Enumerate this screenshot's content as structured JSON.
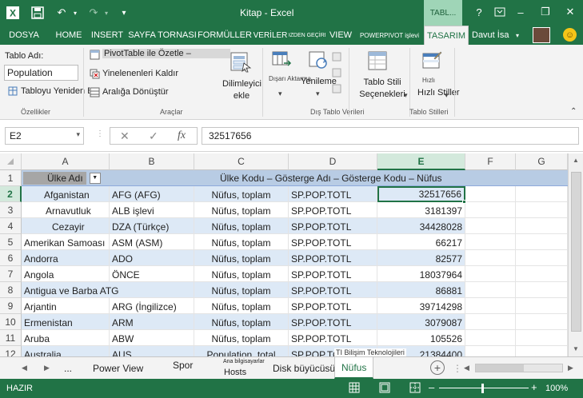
{
  "titlebar": {
    "title": "Kitap - Excel",
    "context_tab": "TABL...",
    "help": "?",
    "min": "–",
    "restore": "❐",
    "close": "✕"
  },
  "tabs": [
    {
      "label": "DOSYA"
    },
    {
      "label": "HOME"
    },
    {
      "label": "INSERT"
    },
    {
      "label": "SAYFA TORNASI"
    },
    {
      "label": "FORMÜLLER"
    },
    {
      "label": "VERİLER"
    },
    {
      "label": "GÖZDEN GEÇİRME"
    },
    {
      "label": "VIEW"
    },
    {
      "label": "POWERPIVOT işlevi"
    },
    {
      "label": "TASARIM"
    }
  ],
  "user": {
    "name": "Davut İsa"
  },
  "ribbon": {
    "table_name_label": "Tablo Adı:",
    "table_name_value": "Population",
    "resize_table": "Tabloyu Yeniden Bo...",
    "group_properties": "Özellikler",
    "pivot_summarize": "PivotTable ile Özetle –",
    "remove_duplicates": "Yinelenenleri Kaldır",
    "convert_to_range": "Aralığa Dönüştür",
    "slicer": "Dilimleyici ekle",
    "group_tools": "Araçlar",
    "export": "Dışarı Aktarma",
    "refresh": "Yenileme",
    "group_external": "Dış Tablo Verileri",
    "style_options": "Tablo Stili Seçenekleri",
    "quick_styles": "Hızlı Stiller",
    "quick_styles_small": "Hızlı",
    "group_styles": "Tablo Stilleri"
  },
  "formula_bar": {
    "name_box": "E2",
    "cancel": "✕",
    "enter": "✓",
    "fx": "fx",
    "value": "32517656"
  },
  "grid": {
    "columns": [
      "A",
      "B",
      "C",
      "D",
      "E",
      "F",
      "G"
    ],
    "header_row": {
      "col_a": "Ülke Adı",
      "merged": "Ülke Kodu – Gösterge Adı – Gösterge Kodu – Nüfus"
    },
    "rows": [
      {
        "n": "1"
      },
      {
        "n": "2",
        "a": "Afganistan",
        "b": "AFG (AFG)",
        "c": "Nüfus, toplam",
        "d": "SP.POP.TOTL",
        "e": "32517656"
      },
      {
        "n": "3",
        "a": "Arnavutluk",
        "b": "ALB işlevi",
        "c": "Nüfus, toplam",
        "d": "SP.POP.TOTL",
        "e": "3181397"
      },
      {
        "n": "4",
        "a": "Cezayir",
        "b": "DZA (Türkçe)",
        "c": "Nüfus, toplam",
        "d": "SP.POP.TOTL",
        "e": "34428028"
      },
      {
        "n": "5",
        "a": "Amerikan Samoası",
        "b": "ASM (ASM)",
        "c": "Nüfus, toplam",
        "d": "SP.POP.TOTL",
        "e": "66217"
      },
      {
        "n": "6",
        "a": "Andorra",
        "b": "ADO",
        "c": "Nüfus, toplam",
        "d": "SP.POP.TOTL",
        "e": "82577"
      },
      {
        "n": "7",
        "a": "Angola",
        "b": "ÖNCE",
        "c": "Nüfus, toplam",
        "d": "SP.POP.TOTL",
        "e": "18037964"
      },
      {
        "n": "8",
        "a": "Antigua ve Barba ATG",
        "b": "",
        "c": "Nüfus, toplam",
        "d": "SP.POP.TOTL",
        "e": "86881"
      },
      {
        "n": "9",
        "a": "Arjantin",
        "b": "ARG (İngilizce)",
        "c": "Nüfus, toplam",
        "d": "SP.POP.TOTL",
        "e": "39714298"
      },
      {
        "n": "10",
        "a": "Ermenistan",
        "b": "ARM",
        "c": "Nüfus, toplam",
        "d": "SP.POP.TOTL",
        "e": "3079087"
      },
      {
        "n": "11",
        "a": "Aruba",
        "b": "ABW",
        "c": "Nüfus, toplam",
        "d": "SP.POP.TOTL",
        "e": "105526"
      },
      {
        "n": "12",
        "a": "Australia",
        "b": "AUS",
        "c": "Population, total",
        "d": "SP.POP.TOTL",
        "e": "21384400"
      }
    ],
    "overlay_text": "TI Bilişim Teknolojileri"
  },
  "sheets": {
    "prev": "◀",
    "next": "▶",
    "more": "...",
    "items": [
      "Power View",
      "Spor",
      "Ana bilgisayarlar",
      "Hosts",
      "Disk büyücüsü",
      "Nüfus"
    ],
    "add": "+"
  },
  "status": {
    "ready": "HAZIR",
    "zoom": "100%",
    "zoom_out": "–",
    "zoom_in": "+"
  }
}
